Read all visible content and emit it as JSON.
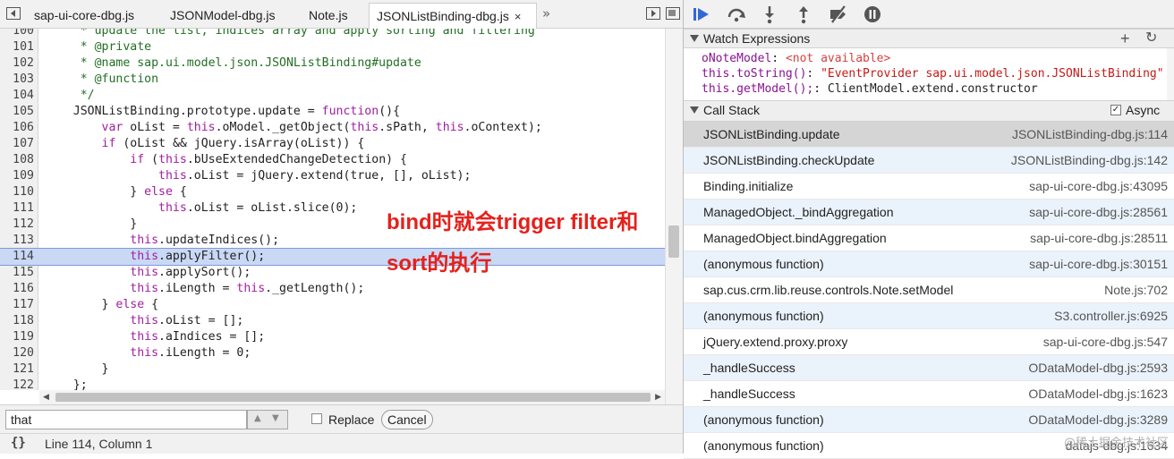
{
  "tabs": [
    {
      "label": "sap-ui-core-dbg.js"
    },
    {
      "label": "JSONModel-dbg.js"
    },
    {
      "label": "Note.js"
    },
    {
      "label": "JSONListBinding-dbg.js",
      "close": "×"
    }
  ],
  "tabs_more": "»",
  "code": {
    "lines": [
      {
        "n": "100",
        "html": "<span class=\"cm\">     * update the list, indices array and apply sorting and filtering</span>"
      },
      {
        "n": "101",
        "html": "<span class=\"cm\">     * @private</span>"
      },
      {
        "n": "102",
        "html": "<span class=\"cm\">     * @name sap.ui.model.json.JSONListBinding#update</span>"
      },
      {
        "n": "103",
        "html": "<span class=\"cm\">     * @function</span>"
      },
      {
        "n": "104",
        "html": "<span class=\"cm\">     */</span>"
      },
      {
        "n": "105",
        "html": "    JSONListBinding.prototype.update = <span class=\"kw\">function</span>(){"
      },
      {
        "n": "106",
        "html": "        <span class=\"kw\">var</span> oList = <span class=\"th\">this</span>.oModel._getObject(<span class=\"th\">this</span>.sPath, <span class=\"th\">this</span>.oContext);"
      },
      {
        "n": "107",
        "html": "        <span class=\"kw\">if</span> (oList &amp;&amp; jQuery.isArray(oList)) {"
      },
      {
        "n": "108",
        "html": "            <span class=\"kw\">if</span> (<span class=\"th\">this</span>.bUseExtendedChangeDetection) {"
      },
      {
        "n": "109",
        "html": "                <span class=\"th\">this</span>.oList = jQuery.extend(true, [], oList);"
      },
      {
        "n": "110",
        "html": "            } <span class=\"kw\">else</span> {"
      },
      {
        "n": "111",
        "html": "                <span class=\"th\">this</span>.oList = oList.slice(0);"
      },
      {
        "n": "112",
        "html": "            }"
      },
      {
        "n": "113",
        "html": "            <span class=\"th\">this</span>.updateIndices();"
      },
      {
        "n": "114",
        "html": "            <span class=\"th\">this</span>.applyFilter();",
        "highlight": true
      },
      {
        "n": "115",
        "html": "            <span class=\"th\">this</span>.applySort();"
      },
      {
        "n": "116",
        "html": "            <span class=\"th\">this</span>.iLength = <span class=\"th\">this</span>._getLength();"
      },
      {
        "n": "117",
        "html": "        } <span class=\"kw\">else</span> {"
      },
      {
        "n": "118",
        "html": "            <span class=\"th\">this</span>.oList = [];"
      },
      {
        "n": "119",
        "html": "            <span class=\"th\">this</span>.aIndices = [];"
      },
      {
        "n": "120",
        "html": "            <span class=\"th\">this</span>.iLength = 0;"
      },
      {
        "n": "121",
        "html": "        }"
      },
      {
        "n": "122",
        "html": "    };"
      },
      {
        "n": "123",
        "html": ""
      }
    ]
  },
  "annotation": {
    "line1": "bind时就会trigger filter和",
    "line2": "sort的执行",
    "color": "#e5211c"
  },
  "search": {
    "value": "that",
    "replace_label": "Replace",
    "cancel_label": "Cancel"
  },
  "status": {
    "pretty_print": "{}",
    "cursor": "Line 114, Column 1"
  },
  "watch": {
    "title": "Watch Expressions",
    "add": "+",
    "refresh": "↻",
    "items": [
      {
        "key": "oNoteModel",
        "sep": ": ",
        "value": "<not available>",
        "kind": "na"
      },
      {
        "key": "this.toString()",
        "sep": ": ",
        "value": "\"EventProvider sap.ui.model.json.JSONListBinding\"",
        "kind": "str"
      },
      {
        "key": "this.getModel();",
        "sep": ": ",
        "value": "ClientModel.extend.constructor",
        "kind": "obj",
        "expandable": true
      }
    ]
  },
  "callstack": {
    "title": "Call Stack",
    "async_label": "Async",
    "async_check": "✓",
    "frames": [
      {
        "fn": "JSONListBinding.update",
        "loc": "JSONListBinding-dbg.js:114"
      },
      {
        "fn": "JSONListBinding.checkUpdate",
        "loc": "JSONListBinding-dbg.js:142"
      },
      {
        "fn": "Binding.initialize",
        "loc": "sap-ui-core-dbg.js:43095"
      },
      {
        "fn": "ManagedObject._bindAggregation",
        "loc": "sap-ui-core-dbg.js:28561"
      },
      {
        "fn": "ManagedObject.bindAggregation",
        "loc": "sap-ui-core-dbg.js:28511"
      },
      {
        "fn": "(anonymous function)",
        "loc": "sap-ui-core-dbg.js:30151"
      },
      {
        "fn": "sap.cus.crm.lib.reuse.controls.Note.setModel",
        "loc": "Note.js:702"
      },
      {
        "fn": "(anonymous function)",
        "loc": "S3.controller.js:6925"
      },
      {
        "fn": "jQuery.extend.proxy.proxy",
        "loc": "sap-ui-core-dbg.js:547"
      },
      {
        "fn": "_handleSuccess",
        "loc": "ODataModel-dbg.js:2593"
      },
      {
        "fn": "_handleSuccess",
        "loc": "ODataModel-dbg.js:1623"
      },
      {
        "fn": "(anonymous function)",
        "loc": "ODataModel-dbg.js:3289"
      },
      {
        "fn": "(anonymous function)",
        "loc": "datajs-dbg.js:1634"
      }
    ]
  },
  "watermark": "@稀土掘金技术社区",
  "colors": {
    "highlight": "#c9d8f5",
    "debug_blue": "#3367d6"
  }
}
